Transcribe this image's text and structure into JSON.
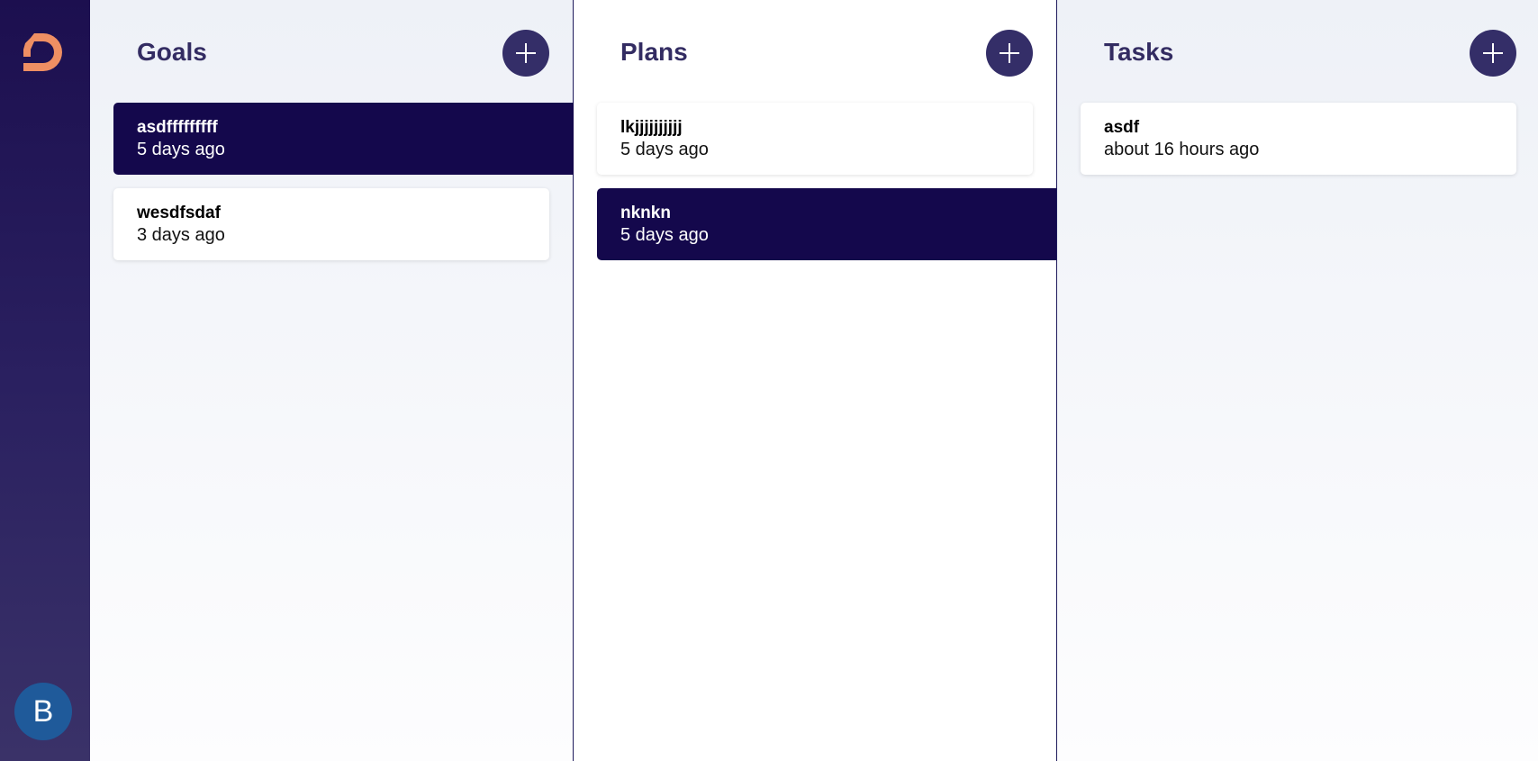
{
  "sidebar": {
    "logo_icon": "logo-d-icon",
    "avatar_initial": "B",
    "colors": {
      "logo": "#ef8f63",
      "avatar": "#1f5a9a"
    }
  },
  "goals": {
    "title": "Goals",
    "add_icon": "plus-icon",
    "items": [
      {
        "title": "asdfffffffff",
        "time": "5 days ago",
        "selected": true
      },
      {
        "title": "wesdfsdaf",
        "time": "3 days ago",
        "selected": false
      }
    ]
  },
  "plans": {
    "title": "Plans",
    "add_icon": "plus-icon",
    "items": [
      {
        "title": "lkjjjjjjjjjj",
        "time": "5 days ago",
        "selected": false
      },
      {
        "title": "nknkn",
        "time": "5 days ago",
        "selected": true
      }
    ]
  },
  "tasks": {
    "title": "Tasks",
    "add_icon": "plus-icon",
    "items": [
      {
        "title": "asdf",
        "time": "about 16 hours ago",
        "selected": false
      }
    ]
  },
  "colors": {
    "accent": "#342e68",
    "selected_card": "#14084c",
    "title_text": "#332c62"
  }
}
